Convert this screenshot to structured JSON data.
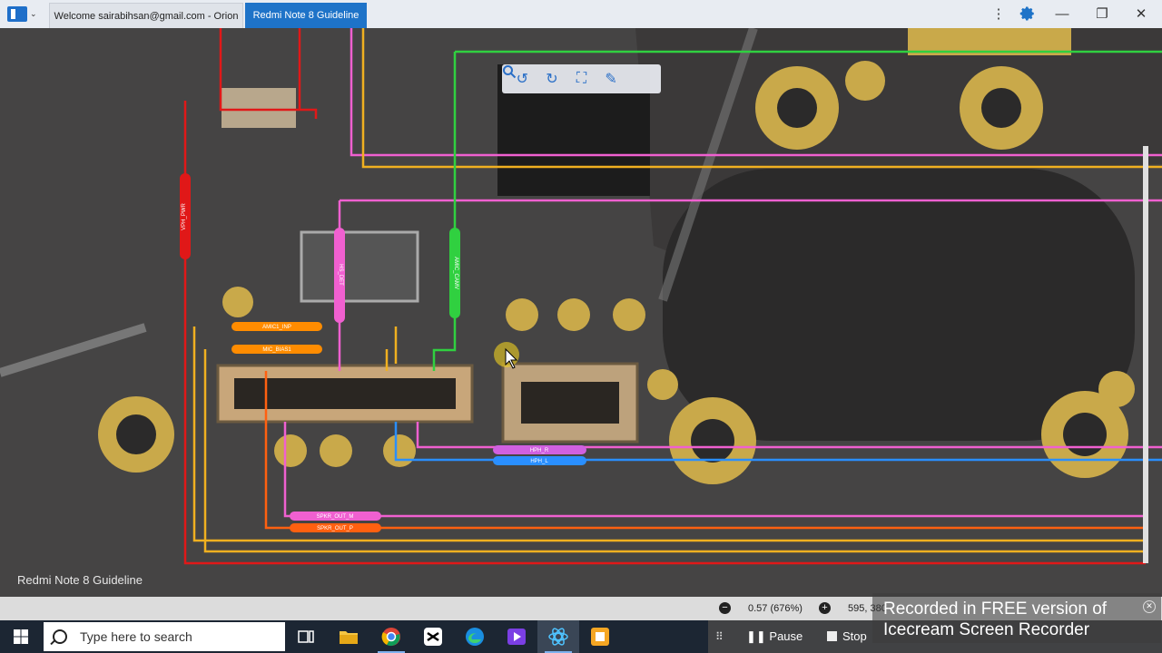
{
  "window": {
    "tabs": [
      {
        "label": "Welcome sairabihsan@gmail.com - Orion"
      },
      {
        "label": "Redmi Note 8 Guideline"
      }
    ],
    "controls": {
      "menu_icon": "kebab-icon",
      "settings_icon": "gear-icon",
      "minimize": "minimize-icon",
      "restore": "restore-icon",
      "close": "close-icon"
    }
  },
  "viewer": {
    "toolbar_icons": [
      "rotate-left-icon",
      "rotate-right-icon",
      "fit-screen-icon",
      "highlight-tool-icon",
      "search-icon"
    ],
    "caption": "Redmi Note 8 Guideline",
    "trace_labels": {
      "vph_pwr": "VPH_PWR",
      "amic1_inp": "AMIC1_INP",
      "mic_bias1": "MIC_BIAS1",
      "hs_det": "HS_DET",
      "amic_cam": "AMIC_CAMV",
      "hph_r": "HPH_R",
      "hph_l": "HPH_L",
      "spkr_out_m": "SPKR_OUT_M",
      "spkr_out_p": "SPKR_OUT_P"
    },
    "trace_colors": {
      "red": "#e01818",
      "orange": "#ff8c00",
      "yellow": "#f0b020",
      "pink": "#f060d0",
      "green": "#30d040",
      "blue": "#2a8fff",
      "orange_dark": "#ff6010"
    }
  },
  "statusbar": {
    "zoom": "0.57 (676%)",
    "coords": "595, 380"
  },
  "watermark": {
    "line1": "Recorded in FREE version of",
    "line2": "Icecream Screen Recorder"
  },
  "taskbar": {
    "search_placeholder": "Type here to search",
    "apps": [
      "task-view-icon",
      "file-explorer-icon",
      "chrome-icon",
      "capcut-icon",
      "edge-icon",
      "video-editor-icon",
      "orion-icon",
      "recorder-icon"
    ],
    "recorder": {
      "pause": "Pause",
      "stop": "Stop"
    }
  }
}
